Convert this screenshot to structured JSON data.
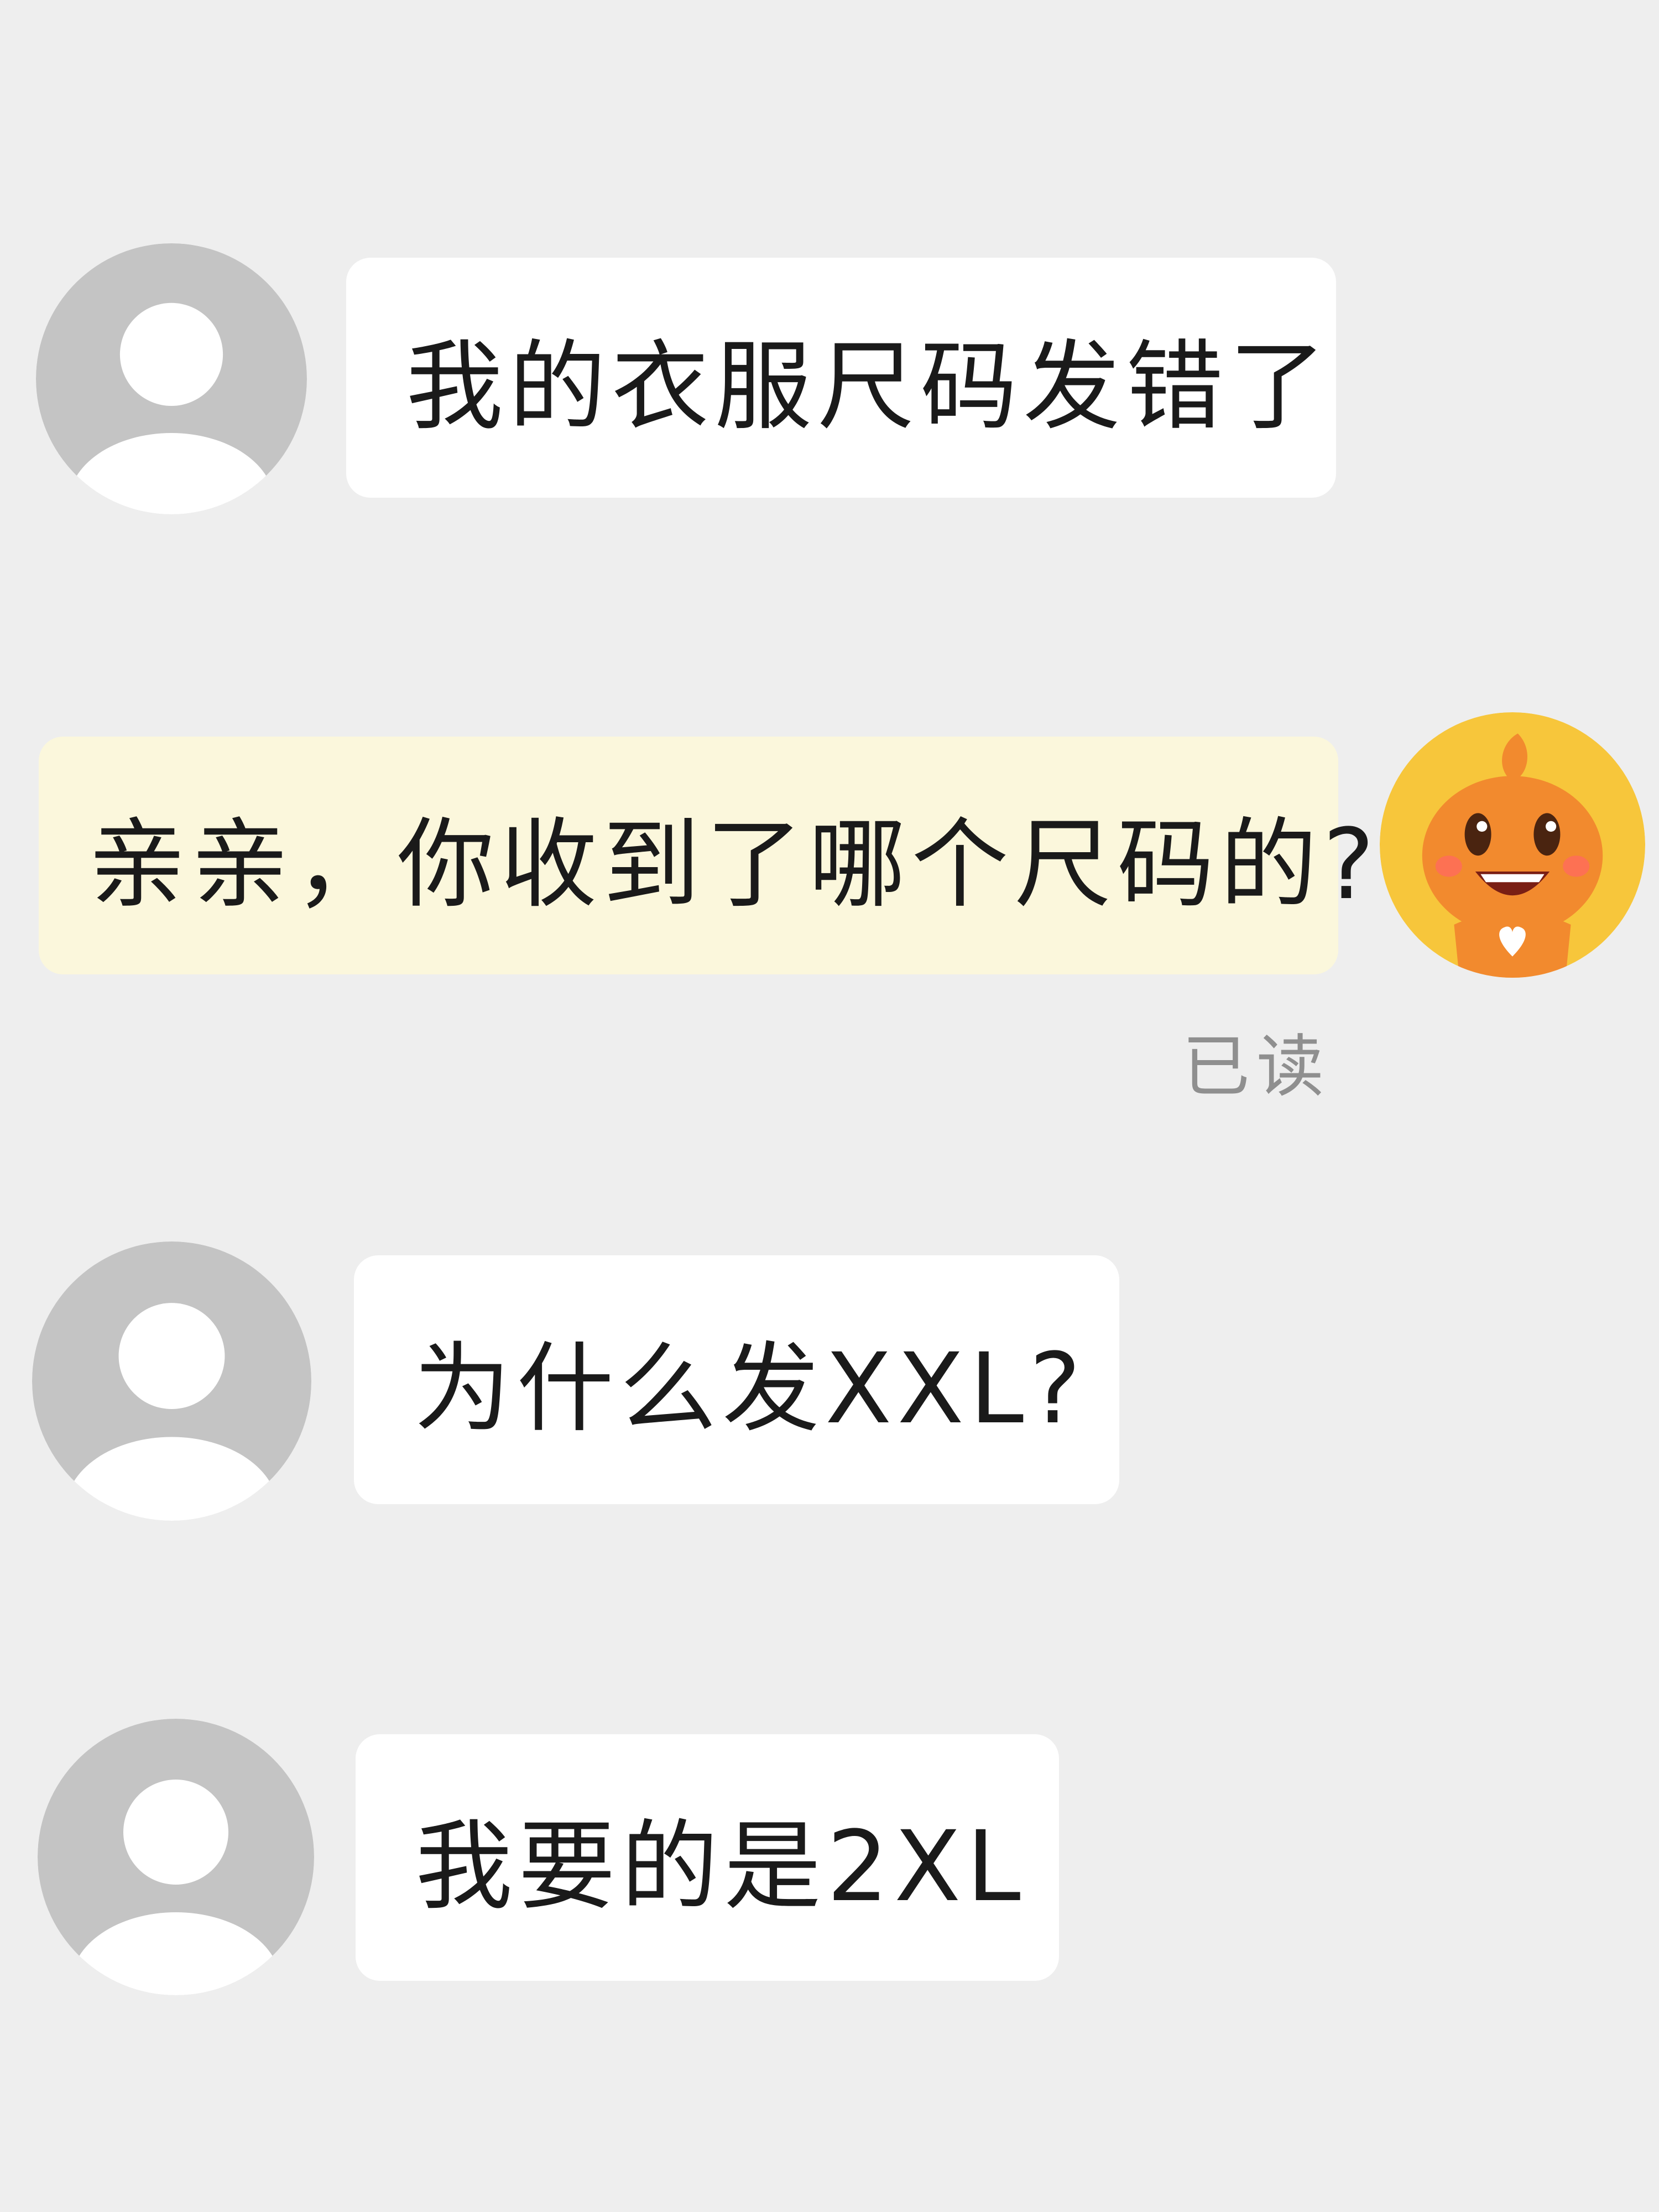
{
  "messages": [
    {
      "id": "m1",
      "sender": "customer",
      "text": "我的衣服尺码发错了"
    },
    {
      "id": "m2",
      "sender": "service",
      "text": "亲亲，你收到了哪个尺码的?",
      "status": "已读"
    },
    {
      "id": "m3",
      "sender": "customer",
      "text": "为什么发XXL?"
    },
    {
      "id": "m4",
      "sender": "customer",
      "text": "我要的是2XL"
    }
  ],
  "colors": {
    "background": "#eeeeee",
    "customer_bubble": "#ffffff",
    "service_bubble": "#fbf7dc",
    "avatar_placeholder": "#c4c4c4",
    "mascot_orange": "#f28a2e",
    "mascot_ring": "#f7c63b"
  },
  "icons": {
    "customer_avatar": "default-user-avatar-icon",
    "service_avatar": "orange-mascot-avatar-icon"
  }
}
